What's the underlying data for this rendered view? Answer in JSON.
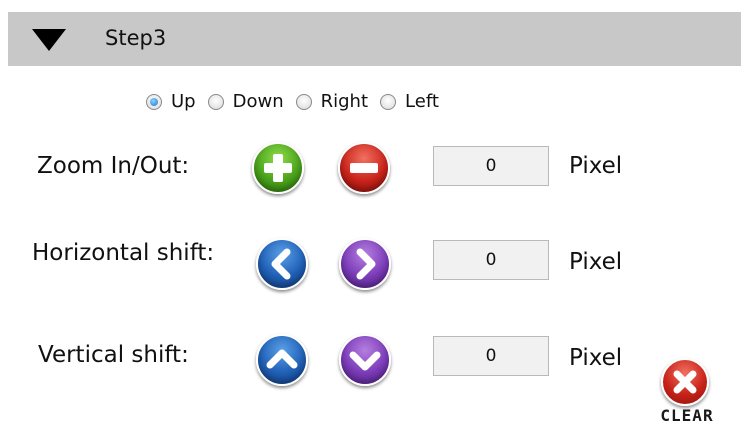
{
  "header": {
    "title": "Step3",
    "collapse_icon": "triangle-down-icon"
  },
  "direction": {
    "options": [
      "Up",
      "Down",
      "Right",
      "Left"
    ],
    "selected": "Up"
  },
  "zoom": {
    "label": "Zoom In/Out:",
    "value": "0",
    "unit": "Pixel",
    "icons": [
      "plus-icon",
      "minus-icon"
    ]
  },
  "horizontal": {
    "label": "Horizontal shift:",
    "value": "0",
    "unit": "Pixel",
    "icons": [
      "chevron-left-icon",
      "chevron-right-icon"
    ]
  },
  "vertical": {
    "label": "Vertical shift:",
    "value": "0",
    "unit": "Pixel",
    "icons": [
      "chevron-up-icon",
      "chevron-down-icon"
    ]
  },
  "clear": {
    "label": "CLEAR",
    "icon": "close-icon"
  },
  "colors": {
    "header_bg": "#c8c8c8",
    "green": "#4aa21b",
    "red": "#c8231a",
    "blue": "#1f5fb5",
    "purple": "#7b3bb8"
  }
}
